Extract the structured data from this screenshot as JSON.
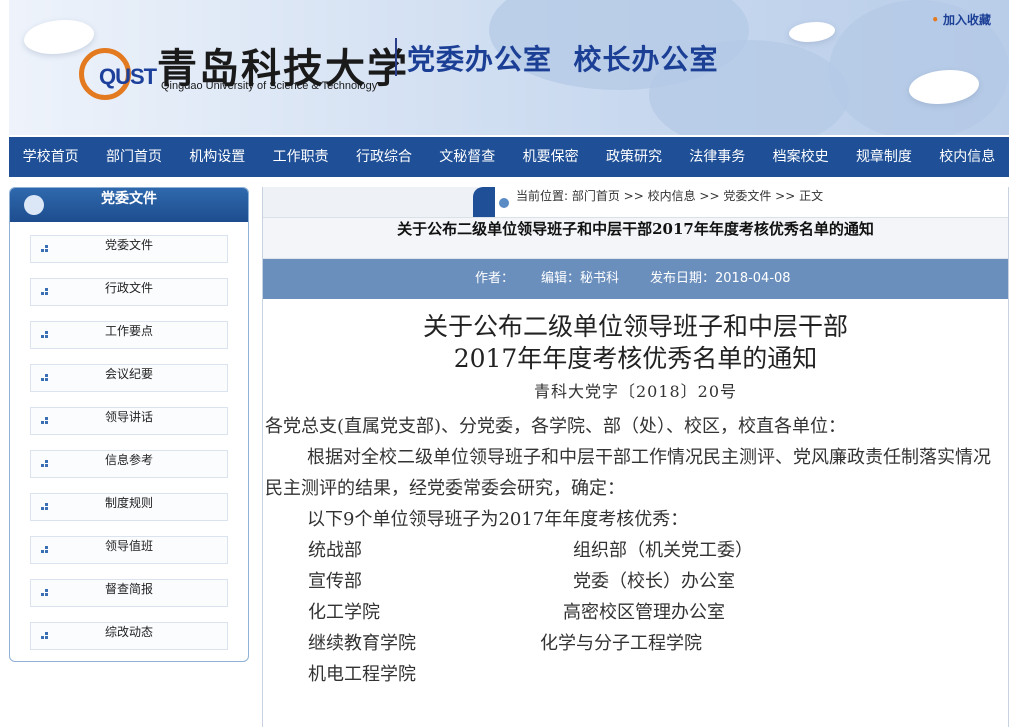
{
  "header": {
    "logo_text": "QUST",
    "school_name": "青岛科技大学",
    "school_name_en": "Qingdao University of Science & Technology",
    "office_name": "党委办公室  校长办公室",
    "favorite": "加入收藏",
    "favorite_bullet": "•"
  },
  "nav": [
    "学校首页",
    "部门首页",
    "机构设置",
    "工作职责",
    "行政综合",
    "文秘督查",
    "机要保密",
    "政策研究",
    "法律事务",
    "档案校史",
    "规章制度",
    "校内信息"
  ],
  "sidebar": {
    "title": "党委文件",
    "items": [
      "党委文件",
      "行政文件",
      "工作要点",
      "会议纪要",
      "领导讲话",
      "信息参考",
      "制度规则",
      "领导值班",
      "督查简报",
      "综改动态"
    ]
  },
  "breadcrumb": "当前位置: 部门首页 >> 校内信息 >> 党委文件 >> 正文",
  "article": {
    "title_bar": "关于公布二级单位领导班子和中层干部2017年年度考核优秀名单的通知",
    "author": "作者：",
    "editor": "编辑：秘书科",
    "date": "发布日期：2018-04-08",
    "heading_line1": "关于公布二级单位领导班子和中层干部",
    "heading_line2": "2017年年度考核优秀名单的通知",
    "doc_number": "青科大党字〔2018〕20号",
    "salutation": "各党总支(直属党支部)、分党委，各学院、部（处）、校区，校直各单位：",
    "para1": "根据对全校二级单位领导班子和中层干部工作情况民主测评、党风廉政责任制落实情况民主测评的结果，经党委常委会研究，确定：",
    "para2": "以下9个单位领导班子为2017年年度考核优秀：",
    "units": [
      [
        "统战部",
        "组织部（机关党工委）"
      ],
      [
        "宣传部",
        "党委（校长）办公室"
      ],
      [
        "化工学院",
        "高密校区管理办公室"
      ],
      [
        "继续教育学院",
        "化学与分子工程学院"
      ],
      [
        "机电工程学院",
        ""
      ]
    ]
  }
}
